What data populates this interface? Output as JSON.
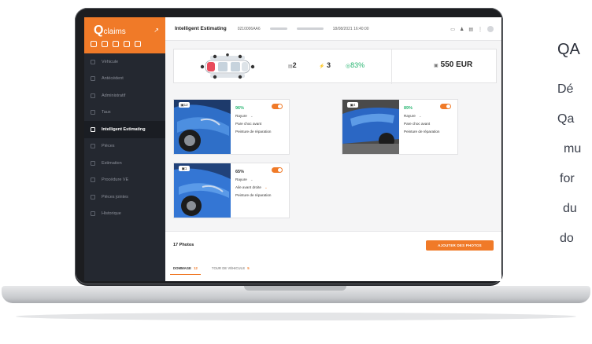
{
  "side": {
    "title": "QA",
    "lines": [
      "Dé",
      "Qa",
      "mu",
      "for",
      "du",
      "do"
    ]
  },
  "app": {
    "logo_main": "Q",
    "logo_text": "claims",
    "sidebar": {
      "items": [
        {
          "label": "Véhicule",
          "icon": "car-icon"
        },
        {
          "label": "Antécédent",
          "icon": "history-icon"
        },
        {
          "label": "Administratif",
          "icon": "document-icon"
        },
        {
          "label": "Taux",
          "icon": "rate-icon"
        },
        {
          "label": "Intelligent Estimating",
          "icon": "ai-icon",
          "active": true
        },
        {
          "label": "Pièces",
          "icon": "parts-icon"
        },
        {
          "label": "Estimation",
          "icon": "estimate-icon"
        },
        {
          "label": "Procédure VE",
          "icon": "procedure-icon"
        },
        {
          "label": "Pièces jointes",
          "icon": "attachment-icon"
        },
        {
          "label": "Historique",
          "icon": "log-icon"
        }
      ]
    },
    "topbar": {
      "title": "Intelligent Estimating",
      "ref": "0210006AA6",
      "datetime": "18/08/2021 16:40:00"
    },
    "summary": {
      "parts_count": "2",
      "damage_count": "3",
      "confidence": "83%",
      "price": "550 EUR"
    },
    "cards": [
      {
        "photo_tag": "12",
        "confidence": "96%",
        "damage": "Rayure",
        "part": "Pare choc avant",
        "operation": "Peinture de réparation"
      },
      {
        "photo_tag": "4",
        "confidence": "89%",
        "damage": "Rayure",
        "part": "Pare choc avant",
        "operation": "Peinture de réparation"
      },
      {
        "photo_tag": "1",
        "confidence": "65%",
        "damage": "Rayure",
        "part": "Aile avant droite",
        "operation": "Peinture de réparation"
      }
    ],
    "photos": {
      "count_label": "17 Photos",
      "add_button": "AJOUTER DES PHOTOS",
      "tab_damage": "DOMMAGE",
      "tab_damage_count": "12",
      "tab_tour": "TOUR DE VÉHICULE",
      "tab_tour_count": "5"
    },
    "colors": {
      "brand": "#f07a28",
      "sidebar": "#242830",
      "success": "#2bb673"
    }
  }
}
